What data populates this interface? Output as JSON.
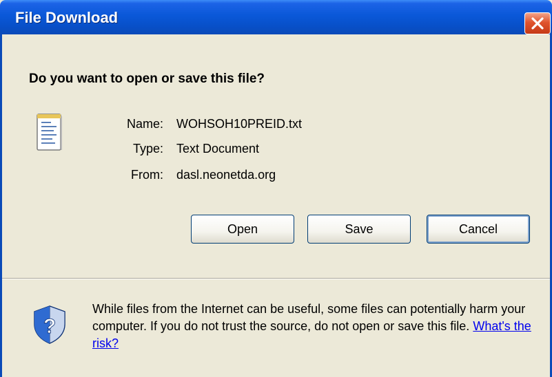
{
  "window": {
    "title": "File Download",
    "close_icon": "close-icon"
  },
  "dialog": {
    "question": "Do you want to open or save this file?",
    "file_icon": "text-file-icon",
    "fields": {
      "name_label": "Name:",
      "name_value": "WOHSOH10PREID.txt",
      "type_label": "Type:",
      "type_value": "Text Document",
      "from_label": "From:",
      "from_value": "dasl.neonetda.org"
    },
    "buttons": {
      "open": "Open",
      "save": "Save",
      "cancel": "Cancel"
    }
  },
  "security": {
    "icon": "security-shield-icon",
    "warning_text": "While files from the Internet can be useful, some files can potentially harm your computer. If you do not trust the source, do not open or save this file.",
    "risk_link": "What's the risk?"
  },
  "colors": {
    "titlebar": "#0A58D8",
    "background": "#ECE9D8",
    "close_button": "#E0542E",
    "link": "#0000EE"
  }
}
